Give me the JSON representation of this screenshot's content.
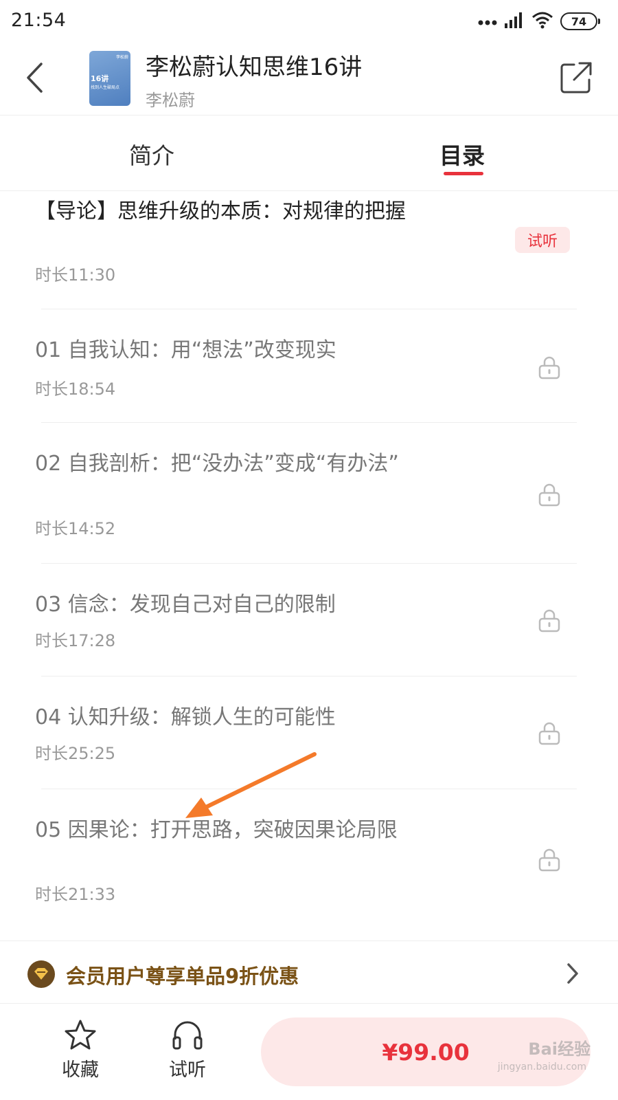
{
  "status_bar": {
    "time": "21:54",
    "battery": "74",
    "icons": [
      "signal-dots-icon",
      "cellular-signal-icon",
      "wifi-icon",
      "battery-icon"
    ]
  },
  "header": {
    "back_icon": "chevron-left-icon",
    "cover": {
      "badge": "16讲",
      "subtitle": "找到人生破局点",
      "side": "李松蔚"
    },
    "title": "李松蔚认知思维16讲",
    "author": "李松蔚",
    "share_icon": "share-icon"
  },
  "tabs": [
    {
      "label": "简介",
      "active": false
    },
    {
      "label": "目录",
      "active": true
    }
  ],
  "colors": {
    "accent": "#e8323c",
    "free_tag_bg": "#fde8e8",
    "member_text": "#7a5216",
    "member_icon_bg": "#6b4a1e",
    "annotation_arrow": "#f47a2a"
  },
  "episodes": [
    {
      "title": "【导论】思维升级的本质：对规律的把握",
      "duration": "时长11:30",
      "free": true,
      "tag": "试听"
    },
    {
      "title": "01 自我认知：用“想法”改变现实",
      "duration": "时长18:54",
      "free": false,
      "icon": "lock-icon"
    },
    {
      "title": "02 自我剖析：把“没办法”变成“有办法”",
      "duration": "时长14:52",
      "free": false,
      "icon": "lock-icon"
    },
    {
      "title": "03 信念：发现自己对自己的限制",
      "duration": "时长17:28",
      "free": false,
      "icon": "lock-icon"
    },
    {
      "title": "04 认知升级：解锁人生的可能性",
      "duration": "时长25:25",
      "free": false,
      "icon": "lock-icon"
    },
    {
      "title": "05 因果论：打开思路，突破因果论局限",
      "duration": "时长21:33",
      "free": false,
      "icon": "lock-icon"
    }
  ],
  "member_banner": {
    "icon": "vip-diamond-icon",
    "text": "会员用户尊享单品9折优惠",
    "arrow_icon": "chevron-right-icon"
  },
  "bottom_bar": {
    "favorite_label": "收藏",
    "favorite_icon": "star-icon",
    "listen_label": "试听",
    "listen_icon": "headphones-icon",
    "price": "¥99.00"
  },
  "watermark": {
    "brand": "Bai经验",
    "url": "jingyan.baidu.com"
  }
}
